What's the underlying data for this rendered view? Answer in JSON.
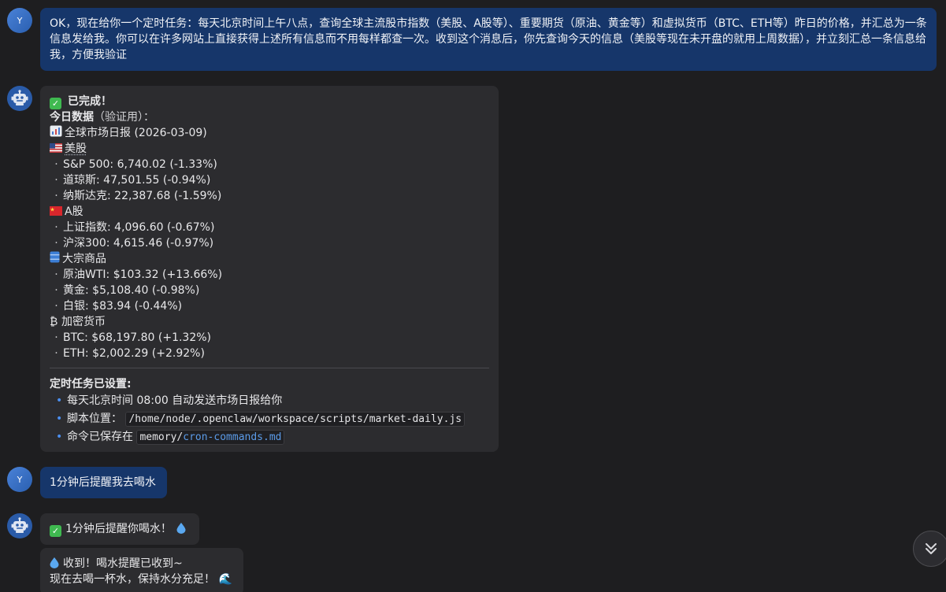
{
  "messages": {
    "user1": {
      "avatar": "Y",
      "text": "OK，现在给你一个定时任务：每天北京时间上午八点，查询全球主流股市指数（美股、A股等）、重要期货（原油、黄金等）和虚拟货币（BTC、ETH等）昨日的价格，并汇总为一条信息发给我。你可以在许多网站上直接获得上述所有信息而不用每样都查一次。收到这个消息后，你先查询今天的信息（美股等现在未开盘的就用上周数据），并立刻汇总一条信息给我，方便我验证"
    },
    "bot1": {
      "done": "已完成！",
      "today_bold": "今日数据",
      "today_rest": "（验证用）：",
      "report_title": "全球市场日报 (2026-03-09)",
      "sections": [
        {
          "icon": "us-flag-icon",
          "title": "美股",
          "items": [
            "S&P 500: 6,740.02 (-1.33%)",
            "道琼斯: 47,501.55 (-0.94%)",
            "纳斯达克: 22,387.68 (-1.59%)"
          ]
        },
        {
          "icon": "cn-flag-icon",
          "title": "A股",
          "items": [
            "上证指数: 4,096.60 (-0.67%)",
            "沪深300: 4,615.46 (-0.97%)"
          ]
        },
        {
          "icon": "barrel-icon",
          "title": "大宗商品",
          "items": [
            "原油WTI: $103.32 (+13.66%)",
            "黄金: $5,108.40 (-0.98%)",
            "白银: $83.94 (-0.44%)"
          ]
        },
        {
          "icon": "bitcoin-icon",
          "title": "加密货币",
          "items": [
            "BTC: $68,197.80 (+1.32%)",
            "ETH: $2,002.29 (+2.92%)"
          ]
        }
      ],
      "cron_title": "定时任务已设置:",
      "cron_items": {
        "schedule": "每天北京时间 08:00 自动发送市场日报给你",
        "script_label": "脚本位置：",
        "script_path": "/home/node/.openclaw/workspace/scripts/market-daily.js",
        "saved_label": "命令已保存在",
        "saved_prefix": "memory/",
        "saved_file": "cron-commands.md"
      }
    },
    "user2": {
      "avatar": "Y",
      "text": "1分钟后提醒我去喝水"
    },
    "bot2": {
      "line1": "1分钟后提醒你喝水！",
      "line2": "收到！喝水提醒已收到~",
      "line3": "现在去喝一杯水，保持水分充足！"
    }
  },
  "colors": {
    "background": "#1e1e20",
    "user_bubble": "#16366a",
    "bot_bubble": "#2c2c2f",
    "accent": "#4b8ff0",
    "check": "#3fb950"
  },
  "icons": [
    "robot-icon",
    "check-icon",
    "chart-icon",
    "water-drop-icon",
    "wave-icon",
    "chevron-double-down-icon"
  ]
}
